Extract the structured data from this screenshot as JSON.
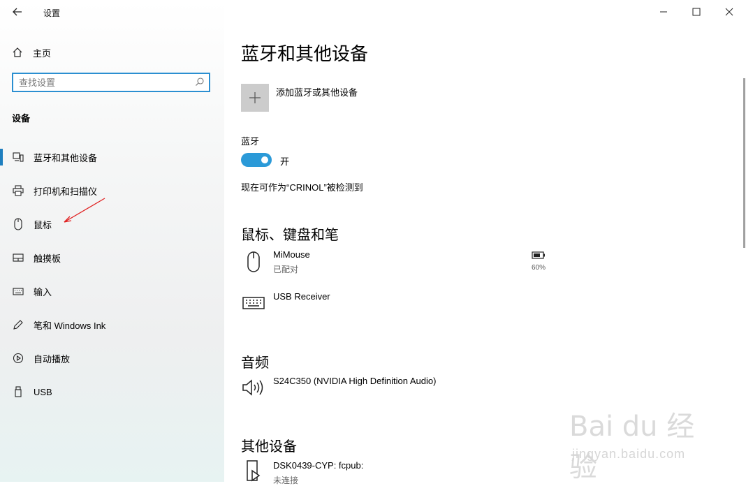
{
  "window": {
    "title": "设置"
  },
  "sidebar": {
    "home_label": "主页",
    "search_placeholder": "查找设置",
    "section_title": "设备",
    "items": [
      {
        "label": "蓝牙和其他设备",
        "icon": "bluetooth-devices-icon",
        "active": true
      },
      {
        "label": "打印机和扫描仪",
        "icon": "printer-icon"
      },
      {
        "label": "鼠标",
        "icon": "mouse-icon"
      },
      {
        "label": "触摸板",
        "icon": "touchpad-icon"
      },
      {
        "label": "输入",
        "icon": "keyboard-icon"
      },
      {
        "label": "笔和 Windows Ink",
        "icon": "pen-icon"
      },
      {
        "label": "自动播放",
        "icon": "autoplay-icon"
      },
      {
        "label": "USB",
        "icon": "usb-icon"
      }
    ]
  },
  "main": {
    "page_title": "蓝牙和其他设备",
    "add_device_label": "添加蓝牙或其他设备",
    "bluetooth_label": "蓝牙",
    "bluetooth_state": "开",
    "bluetooth_on": true,
    "discoverable_text": "现在可作为“CRINOL”被检测到",
    "sections": {
      "input_title": "鼠标、键盘和笔",
      "audio_title": "音频",
      "other_title": "其他设备"
    },
    "input_devices": [
      {
        "name": "MiMouse",
        "status": "已配对",
        "battery": "60%",
        "icon": "mouse-icon"
      },
      {
        "name": "USB Receiver",
        "status": "",
        "icon": "keyboard-icon"
      }
    ],
    "audio_devices": [
      {
        "name": "S24C350 (NVIDIA High Definition Audio)",
        "icon": "speaker-icon"
      }
    ],
    "other_devices": [
      {
        "name": "DSK0439-CYP: fcpub:",
        "status": "未连接",
        "icon": "media-device-icon"
      }
    ]
  },
  "watermark": {
    "main": "Bai du 经验",
    "sub": "jingyan.baidu.com"
  },
  "colors": {
    "accent": "#2b9ad8",
    "active_bar": "#1f7fbf",
    "search_border": "#2b8fd1"
  }
}
